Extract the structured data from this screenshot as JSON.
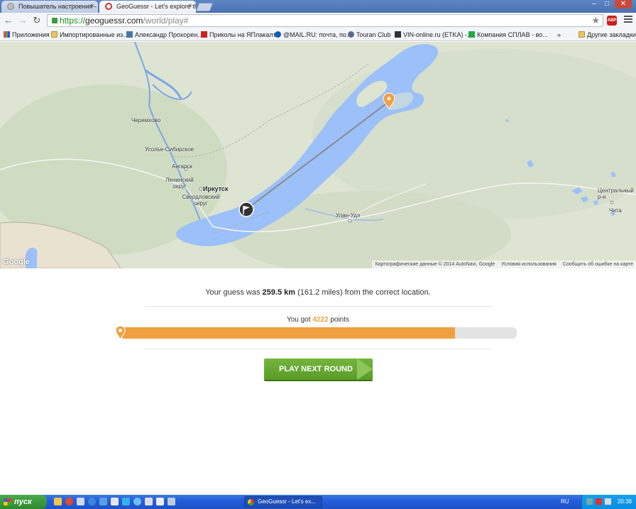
{
  "browser": {
    "tabs": [
      {
        "title": "Повышатель настроения -",
        "active": false
      },
      {
        "title": "GeoGuessr - Let's explore th",
        "active": true
      }
    ],
    "tab_close": "×",
    "url_scheme": "https://",
    "url_host": "geoguessr.com",
    "url_path": "/world/play#",
    "star_icon": "★",
    "abp_label": "ABP",
    "window_controls": [
      "–",
      "□",
      "✕"
    ],
    "nav": {
      "back": "←",
      "forward": "→",
      "reload": "↻"
    },
    "bookmarks": [
      {
        "label": "Приложения",
        "icon": "grid"
      },
      {
        "label": "Импортированные из...",
        "icon": "folder"
      },
      {
        "label": "Александр Прохорен...",
        "icon": "vk"
      },
      {
        "label": "Приколы на ЯПлакалъ",
        "icon": "yap"
      },
      {
        "label": "@MAIL.RU: почта, по...",
        "icon": "mail"
      },
      {
        "label": "Touran Club",
        "icon": "vw"
      },
      {
        "label": "VIN-online.ru (ETKA) -...",
        "icon": "vin"
      },
      {
        "label": "Компания СПЛАВ - во...",
        "icon": "splav"
      },
      {
        "label": "»",
        "icon": "none"
      },
      {
        "label": "Другие закладки",
        "icon": "folder"
      }
    ]
  },
  "map": {
    "labels": {
      "cheremkhovo": "Черемхово",
      "usolye": "Усолье-Сибирское",
      "angarsk": "Ангарск",
      "leninsky": "Ленинский округ",
      "irkutsk": "Иркутск",
      "sverdlovsky": "Свердловский округ",
      "ulan_ude": "Улан-Удэ",
      "central": "Центральный р-н",
      "chita": "Чита",
      "google": "Google"
    },
    "attribution": {
      "data": "Картографические данные © 2014 AutoNavi, Google",
      "terms": "Условия использования",
      "report": "Сообщить об ошибке на карте"
    }
  },
  "result": {
    "distance_prefix": "Your guess was ",
    "distance_km": "259.5 km",
    "distance_miles": " (161.2 miles) from the correct location.",
    "points_prefix": "You got ",
    "points_value": "4222",
    "points_suffix": " points",
    "points_fraction": 0.8444,
    "play_button": "PLAY NEXT ROUND"
  },
  "taskbar": {
    "start_label": "пуск",
    "window_item": "GeoGuessr - Let's ex...",
    "language": "RU",
    "clock": "20:38"
  },
  "colors": {
    "accent_orange": "#f0a040",
    "button_green": "#6aa832",
    "lake_blue": "#9cc0f9"
  }
}
